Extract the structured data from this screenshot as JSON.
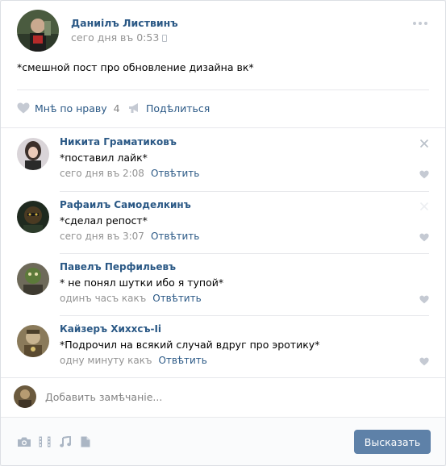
{
  "post": {
    "author": "Даниiлъ Листвинъ",
    "date": "сего дня въ 0:53",
    "text": "*смешной пост про обновление дизайна вк*",
    "like_label": "Мнѣ по нраву",
    "like_count": "4",
    "share_label": "Подѣлиться"
  },
  "comments": [
    {
      "name": "Никита Граматиковъ",
      "text": "*поставил лайк*",
      "time": "сего дня въ 2:08",
      "reply": "Отвѣтить"
    },
    {
      "name": "Рафаилъ Самоделкинъ",
      "text": "*сделал репост*",
      "time": "сего дня въ 3:07",
      "reply": "Отвѣтить"
    },
    {
      "name": "Павелъ Перфильевъ",
      "text": "* не понял шутки ибо я тупой*",
      "time": "одинъ часъ какъ",
      "reply": "Отвѣтить"
    },
    {
      "name": "Кайзеръ Хиххсъ-Ii",
      "text": "*Подрочил на всякий случай вдруг про эротику*",
      "time": "одну минуту какъ",
      "reply": "Отвѣтить"
    }
  ],
  "composer": {
    "placeholder": "Добавить замѣчаніе...",
    "submit_label": "Высказать"
  },
  "colors": {
    "link": "#2a5885",
    "muted": "#939393",
    "button": "#5e81a8",
    "icon": "#c5cad3"
  }
}
